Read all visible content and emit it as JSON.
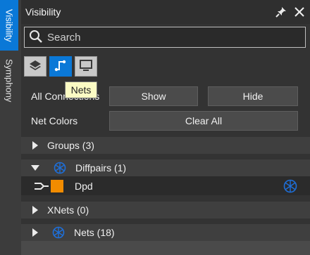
{
  "side_tabs": [
    {
      "label": "Visibility",
      "active": true
    },
    {
      "label": "Symphony",
      "active": false
    }
  ],
  "panel": {
    "title": "Visibility",
    "pin_icon": "pin-icon",
    "close_icon": "close-icon"
  },
  "search": {
    "placeholder": "Search",
    "value": ""
  },
  "mode_buttons": [
    {
      "name": "layers",
      "icon": "layers-icon",
      "active": false
    },
    {
      "name": "nets",
      "icon": "net-route-icon",
      "active": true
    },
    {
      "name": "display",
      "icon": "monitor-icon",
      "active": false
    }
  ],
  "tooltip": "Nets",
  "controls": {
    "all_connections": {
      "label": "All Connections",
      "show": "Show",
      "hide": "Hide"
    },
    "net_colors": {
      "label": "Net Colors",
      "clear": "Clear All"
    }
  },
  "tree": {
    "groups": "Groups (3)",
    "diffpairs": "Diffpairs (1)",
    "dpd": "Dpd",
    "xnets": "XNets (0)",
    "nets": "Nets (18)"
  },
  "colors": {
    "accent": "#0a78d7",
    "dpd_swatch": "#f28c00",
    "net_icon": "#1e6fd9"
  }
}
